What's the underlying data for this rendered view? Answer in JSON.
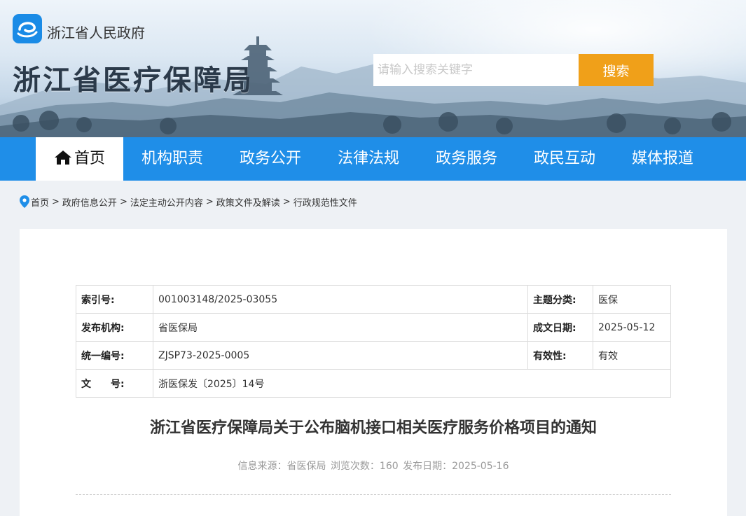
{
  "header": {
    "gov_name": "浙江省人民政府",
    "site_title": "浙江省医疗保障局",
    "search_placeholder": "请输入搜索关键字",
    "search_button": "搜索"
  },
  "nav": {
    "items": [
      "首页",
      "机构职责",
      "政务公开",
      "法律法规",
      "政务服务",
      "政民互动",
      "媒体报道"
    ],
    "active_index": 0
  },
  "breadcrumb": [
    "首页",
    "政府信息公开",
    "法定主动公开内容",
    "政策文件及解读",
    "行政规范性文件"
  ],
  "meta": {
    "index_label": "索引号:",
    "index_value": "001003148/2025-03055",
    "topic_label": "主题分类:",
    "topic_value": "医保",
    "issuer_label": "发布机构:",
    "issuer_value": "省医保局",
    "date_label": "成文日期:",
    "date_value": "2025-05-12",
    "code_label": "统一编号:",
    "code_value": "ZJSP73-2025-0005",
    "validity_label": "有效性:",
    "validity_value": "有效",
    "doc_label": "文　　号:",
    "doc_value": "浙医保发〔2025〕14号"
  },
  "document": {
    "title": "浙江省医疗保障局关于公布脑机接口相关医疗服务价格项目的通知",
    "info_source": "信息来源：省医保局",
    "info_views": "浏览次数：160",
    "info_date": "发布日期：2025-05-16"
  },
  "colors": {
    "nav": "#1f8ee8",
    "search_button": "#f0a019",
    "logo": "#1a8be6"
  }
}
